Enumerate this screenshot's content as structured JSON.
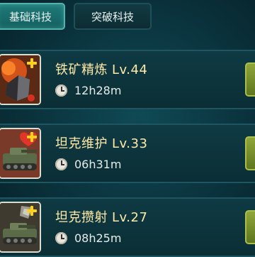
{
  "tabs": [
    {
      "label": "基础科技",
      "active": true
    },
    {
      "label": "突破科技",
      "active": false
    }
  ],
  "tech_list": [
    {
      "name": "铁矿精炼",
      "level": "Lv.44",
      "time": "12h28m",
      "icon": "iron-ore-icon"
    },
    {
      "name": "坦克维护",
      "level": "Lv.33",
      "time": "06h31m",
      "icon": "tank-repair-icon"
    },
    {
      "name": "坦克攒射",
      "level": "Lv.27",
      "time": "08h25m",
      "icon": "tank-volley-icon"
    }
  ],
  "colors": {
    "accent": "#ffd21a",
    "title_text": "#ffe9a8",
    "panel_bg": "#0f3a43",
    "button_green": "#8fa63a"
  }
}
